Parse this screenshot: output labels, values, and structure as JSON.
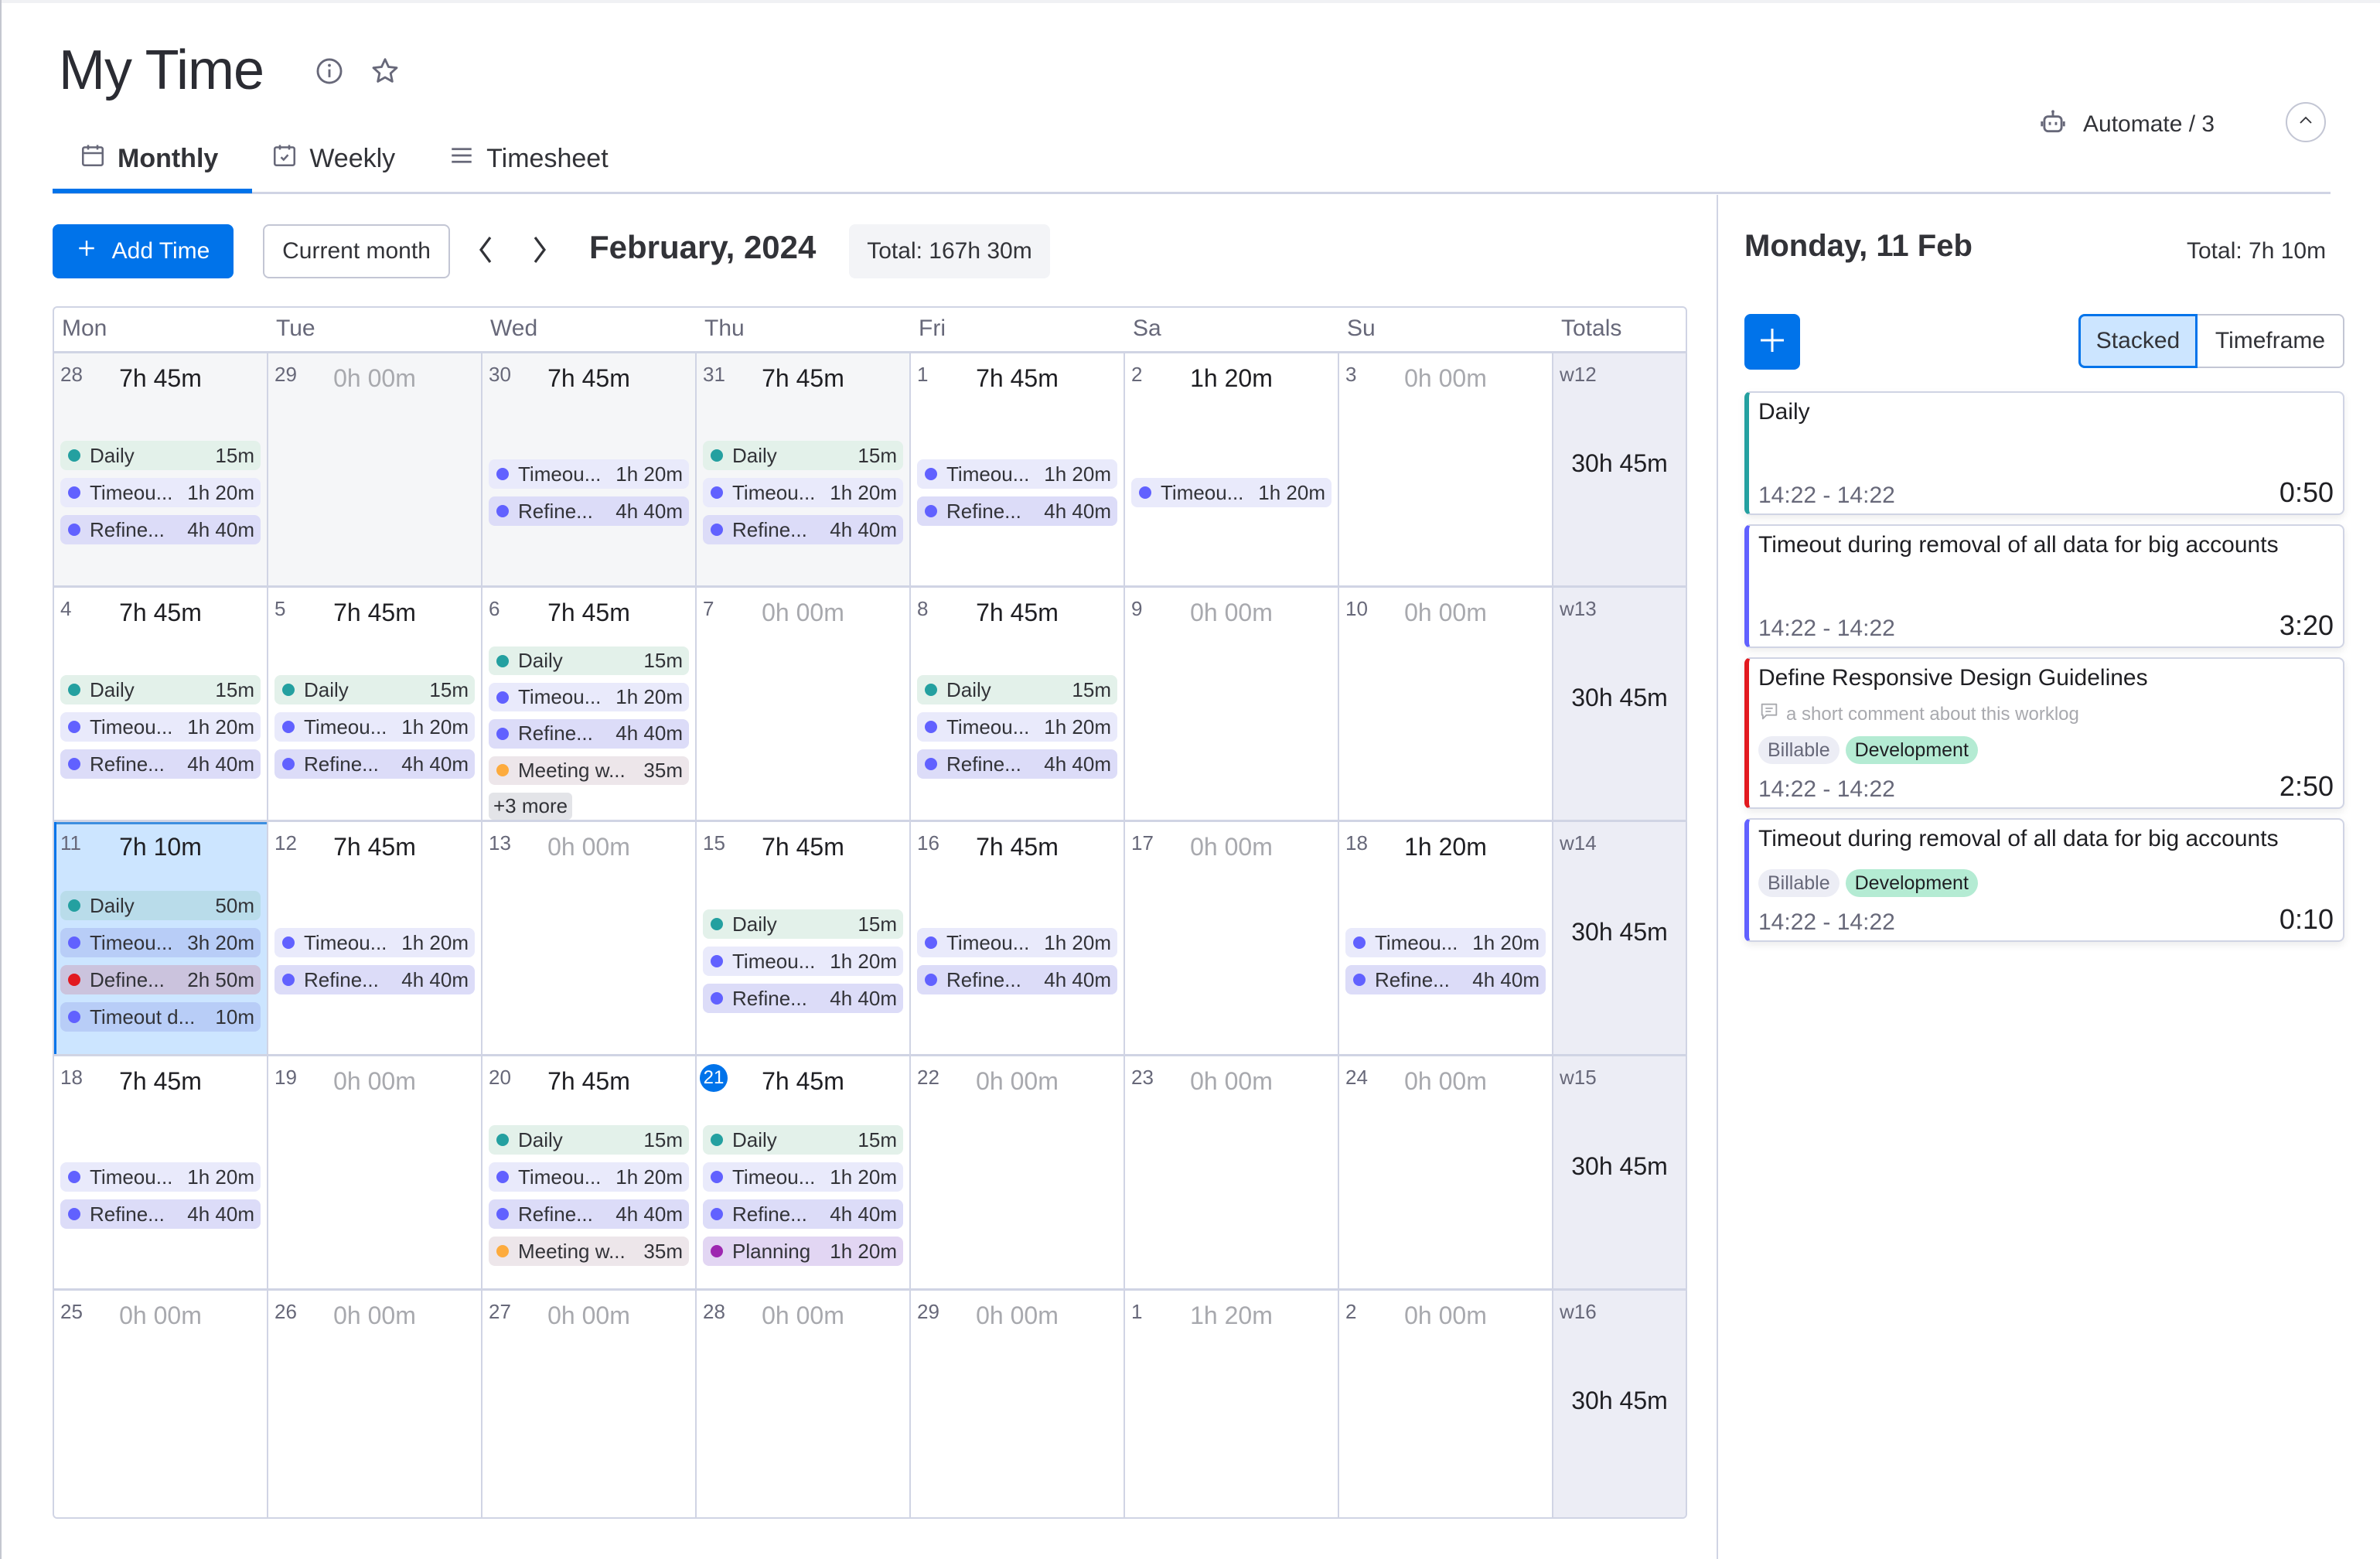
{
  "header": {
    "title": "My Time",
    "tabs": [
      {
        "label": "Monthly",
        "icon": "calendar-icon",
        "active": true
      },
      {
        "label": "Weekly",
        "icon": "calendar-check-icon",
        "active": false
      },
      {
        "label": "Timesheet",
        "icon": "list-icon",
        "active": false
      }
    ],
    "automate_label": "Automate / 3"
  },
  "toolbar": {
    "add_label": "Add Time",
    "current_month_label": "Current month",
    "month_label": "February, 2024",
    "total_label": "Total: 167h 30m"
  },
  "colors": {
    "accent": "#0073ea",
    "daily": "#24a0a0",
    "timeout": "#6161ff",
    "refine": "#6161ff",
    "define": "#e2191f",
    "meeting": "#fdab3d",
    "planning": "#9d27b0"
  },
  "calendar": {
    "headers": [
      "Mon",
      "Tue",
      "Wed",
      "Thu",
      "Fri",
      "Sa",
      "Su",
      "Totals"
    ],
    "weeks": [
      {
        "label": "w12",
        "total": "30h 45m",
        "days": [
          {
            "num": "28",
            "total": "7h 45m",
            "muted": true,
            "events": [
              {
                "name": "Daily",
                "dur": "15m",
                "kind": "daily"
              },
              {
                "name": "Timeou...",
                "dur": "1h 20m",
                "kind": "timeout"
              },
              {
                "name": "Refine...",
                "dur": "4h 40m",
                "kind": "refine"
              }
            ]
          },
          {
            "num": "29",
            "total": "0h 00m",
            "muted": true,
            "zero": true,
            "events": []
          },
          {
            "num": "30",
            "total": "7h 45m",
            "muted": true,
            "events": [
              {
                "name": "Timeou...",
                "dur": "1h 20m",
                "kind": "timeout"
              },
              {
                "name": "Refine...",
                "dur": "4h 40m",
                "kind": "refine"
              }
            ]
          },
          {
            "num": "31",
            "total": "7h 45m",
            "muted": true,
            "events": [
              {
                "name": "Daily",
                "dur": "15m",
                "kind": "daily"
              },
              {
                "name": "Timeou...",
                "dur": "1h 20m",
                "kind": "timeout"
              },
              {
                "name": "Refine...",
                "dur": "4h 40m",
                "kind": "refine"
              }
            ]
          },
          {
            "num": "1",
            "total": "7h 45m",
            "events": [
              {
                "name": "Timeou...",
                "dur": "1h 20m",
                "kind": "timeout"
              },
              {
                "name": "Refine...",
                "dur": "4h 40m",
                "kind": "refine"
              }
            ]
          },
          {
            "num": "2",
            "total": "1h 20m",
            "events": [
              {
                "name": "Timeou...",
                "dur": "1h 20m",
                "kind": "timeout"
              }
            ]
          },
          {
            "num": "3",
            "total": "0h 00m",
            "zero": true,
            "events": []
          }
        ]
      },
      {
        "label": "w13",
        "total": "30h 45m",
        "days": [
          {
            "num": "4",
            "total": "7h 45m",
            "events": [
              {
                "name": "Daily",
                "dur": "15m",
                "kind": "daily"
              },
              {
                "name": "Timeou...",
                "dur": "1h 20m",
                "kind": "timeout"
              },
              {
                "name": "Refine...",
                "dur": "4h 40m",
                "kind": "refine"
              }
            ]
          },
          {
            "num": "5",
            "total": "7h 45m",
            "events": [
              {
                "name": "Daily",
                "dur": "15m",
                "kind": "daily"
              },
              {
                "name": "Timeou...",
                "dur": "1h 20m",
                "kind": "timeout"
              },
              {
                "name": "Refine...",
                "dur": "4h 40m",
                "kind": "refine"
              }
            ]
          },
          {
            "num": "6",
            "total": "7h 45m",
            "more": "+3 more",
            "events": [
              {
                "name": "Daily",
                "dur": "15m",
                "kind": "daily"
              },
              {
                "name": "Timeou...",
                "dur": "1h 20m",
                "kind": "timeout"
              },
              {
                "name": "Refine...",
                "dur": "4h 40m",
                "kind": "refine"
              },
              {
                "name": "Meeting w...",
                "dur": "35m",
                "kind": "meeting"
              }
            ]
          },
          {
            "num": "7",
            "total": "0h 00m",
            "zero": true,
            "events": []
          },
          {
            "num": "8",
            "total": "7h 45m",
            "events": [
              {
                "name": "Daily",
                "dur": "15m",
                "kind": "daily"
              },
              {
                "name": "Timeou...",
                "dur": "1h 20m",
                "kind": "timeout"
              },
              {
                "name": "Refine...",
                "dur": "4h 40m",
                "kind": "refine"
              }
            ]
          },
          {
            "num": "9",
            "total": "0h 00m",
            "zero": true,
            "events": []
          },
          {
            "num": "10",
            "total": "0h 00m",
            "zero": true,
            "events": []
          }
        ]
      },
      {
        "label": "w14",
        "total": "30h 45m",
        "days": [
          {
            "num": "11",
            "total": "7h 10m",
            "selected": true,
            "events": [
              {
                "name": "Daily",
                "dur": "50m",
                "kind": "daily"
              },
              {
                "name": "Timeou...",
                "dur": "3h 20m",
                "kind": "timeout"
              },
              {
                "name": "Define...",
                "dur": "2h 50m",
                "kind": "define"
              },
              {
                "name": "Timeout d...",
                "dur": "10m",
                "kind": "timeout"
              }
            ]
          },
          {
            "num": "12",
            "total": "7h 45m",
            "events": [
              {
                "name": "Timeou...",
                "dur": "1h 20m",
                "kind": "timeout"
              },
              {
                "name": "Refine...",
                "dur": "4h 40m",
                "kind": "refine"
              }
            ]
          },
          {
            "num": "13",
            "total": "0h 00m",
            "zero": true,
            "events": []
          },
          {
            "num": "15",
            "total": "7h 45m",
            "events": [
              {
                "name": "Daily",
                "dur": "15m",
                "kind": "daily"
              },
              {
                "name": "Timeou...",
                "dur": "1h 20m",
                "kind": "timeout"
              },
              {
                "name": "Refine...",
                "dur": "4h 40m",
                "kind": "refine"
              }
            ]
          },
          {
            "num": "16",
            "total": "7h 45m",
            "events": [
              {
                "name": "Timeou...",
                "dur": "1h 20m",
                "kind": "timeout"
              },
              {
                "name": "Refine...",
                "dur": "4h 40m",
                "kind": "refine"
              }
            ]
          },
          {
            "num": "17",
            "total": "0h 00m",
            "zero": true,
            "events": []
          },
          {
            "num": "18",
            "total": "1h 20m",
            "events": [
              {
                "name": "Timeou...",
                "dur": "1h 20m",
                "kind": "timeout"
              },
              {
                "name": "Refine...",
                "dur": "4h 40m",
                "kind": "refine"
              }
            ]
          }
        ]
      },
      {
        "label": "w15",
        "total": "30h 45m",
        "days": [
          {
            "num": "18",
            "total": "7h 45m",
            "events": [
              {
                "name": "Timeou...",
                "dur": "1h 20m",
                "kind": "timeout"
              },
              {
                "name": "Refine...",
                "dur": "4h 40m",
                "kind": "refine"
              }
            ]
          },
          {
            "num": "19",
            "total": "0h 00m",
            "zero": true,
            "events": []
          },
          {
            "num": "20",
            "total": "7h 45m",
            "events": [
              {
                "name": "Daily",
                "dur": "15m",
                "kind": "daily"
              },
              {
                "name": "Timeou...",
                "dur": "1h 20m",
                "kind": "timeout"
              },
              {
                "name": "Refine...",
                "dur": "4h 40m",
                "kind": "refine"
              },
              {
                "name": "Meeting w...",
                "dur": "35m",
                "kind": "meeting"
              }
            ]
          },
          {
            "num": "21",
            "total": "7h 45m",
            "today": true,
            "events": [
              {
                "name": "Daily",
                "dur": "15m",
                "kind": "daily"
              },
              {
                "name": "Timeou...",
                "dur": "1h 20m",
                "kind": "timeout"
              },
              {
                "name": "Refine...",
                "dur": "4h 40m",
                "kind": "refine"
              },
              {
                "name": "Planning",
                "dur": "1h 20m",
                "kind": "planning"
              }
            ]
          },
          {
            "num": "22",
            "total": "0h 00m",
            "zero": true,
            "events": []
          },
          {
            "num": "23",
            "total": "0h 00m",
            "zero": true,
            "events": []
          },
          {
            "num": "24",
            "total": "0h 00m",
            "zero": true,
            "events": []
          }
        ]
      },
      {
        "label": "w16",
        "total": "30h 45m",
        "days": [
          {
            "num": "25",
            "total": "0h 00m",
            "zero": true,
            "events": []
          },
          {
            "num": "26",
            "total": "0h 00m",
            "zero": true,
            "events": []
          },
          {
            "num": "27",
            "total": "0h 00m",
            "zero": true,
            "events": []
          },
          {
            "num": "28",
            "total": "0h 00m",
            "zero": true,
            "events": []
          },
          {
            "num": "29",
            "total": "0h 00m",
            "zero": true,
            "events": []
          },
          {
            "num": "1",
            "total": "1h 20m",
            "zero": true,
            "events": []
          },
          {
            "num": "2",
            "total": "0h 00m",
            "zero": true,
            "events": []
          }
        ]
      }
    ]
  },
  "day_panel": {
    "date_label": "Monday, 11 Feb",
    "total_label": "Total: 7h 10m",
    "view_options": [
      {
        "label": "Stacked",
        "active": true
      },
      {
        "label": "Timeframe",
        "active": false
      }
    ],
    "worklogs": [
      {
        "title": "Daily",
        "kind": "daily",
        "range": "14:22 - 14:22",
        "duration": "0:50",
        "comment": null,
        "tags": []
      },
      {
        "title": "Timeout during removal of all data for big accounts",
        "kind": "timeout",
        "range": "14:22 - 14:22",
        "duration": "3:20",
        "comment": null,
        "tags": []
      },
      {
        "title": "Define Responsive Design Guidelines",
        "kind": "define",
        "range": "14:22 - 14:22",
        "duration": "2:50",
        "comment": "a short comment about this worklog",
        "tags": [
          "Billable",
          "Development"
        ]
      },
      {
        "title": "Timeout during removal of all data for big accounts",
        "kind": "timeout",
        "range": "14:22 - 14:22",
        "duration": "0:10",
        "comment": null,
        "tags": [
          "Billable",
          "Development"
        ]
      }
    ]
  }
}
